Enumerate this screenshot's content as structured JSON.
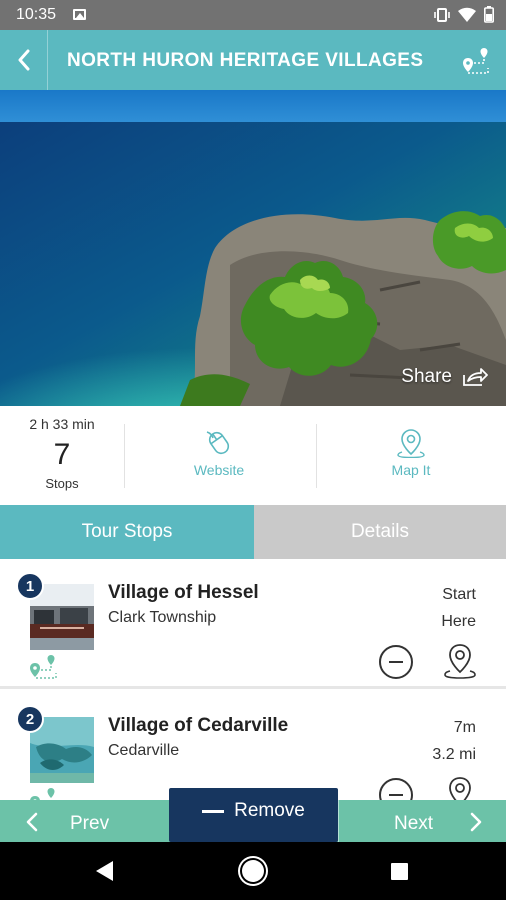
{
  "status_bar": {
    "time": "10:35"
  },
  "header": {
    "title": "NORTH HURON HERITAGE VILLAGES"
  },
  "hero": {
    "share_label": "Share"
  },
  "tour_info": {
    "duration": "2 h 33 min",
    "stop_count": "7",
    "stops_label": "Stops",
    "website_label": "Website",
    "map_label": "Map It"
  },
  "tabs": [
    {
      "label": "Tour Stops",
      "active": true
    },
    {
      "label": "Details",
      "active": false
    }
  ],
  "stops": [
    {
      "number": "1",
      "name": "Village of Hessel",
      "subtitle": "Clark Township",
      "meta_line1": "Start",
      "meta_line2": "Here"
    },
    {
      "number": "2",
      "name": "Village of Cedarville",
      "subtitle": "Cedarville",
      "meta_line1": "7m",
      "meta_line2": "3.2 mi"
    }
  ],
  "bottom_bar": {
    "prev_label": "Prev",
    "remove_label": "Remove",
    "next_label": "Next"
  },
  "colors": {
    "teal": "#5bb9c0",
    "green": "#6cc2a8",
    "navy": "#17365f",
    "inactive_tab": "#c9c9c9"
  }
}
